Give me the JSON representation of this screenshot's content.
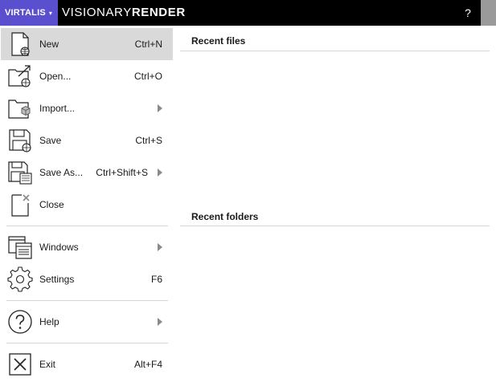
{
  "titlebar": {
    "brand": "VIRTALIS",
    "brand_caret": "▾",
    "app_name_light": "VISIONARY",
    "app_name_bold": "RENDER",
    "help": "?"
  },
  "menu": {
    "new": {
      "label": "New",
      "shortcut": "Ctrl+N"
    },
    "open": {
      "label": "Open...",
      "shortcut": "Ctrl+O"
    },
    "import": {
      "label": "Import..."
    },
    "save": {
      "label": "Save",
      "shortcut": "Ctrl+S"
    },
    "save_as": {
      "label": "Save As...",
      "shortcut": "Ctrl+Shift+S"
    },
    "close": {
      "label": "Close"
    },
    "windows": {
      "label": "Windows"
    },
    "settings": {
      "label": "Settings",
      "shortcut": "F6"
    },
    "help": {
      "label": "Help"
    },
    "exit": {
      "label": "Exit",
      "shortcut": "Alt+F4"
    }
  },
  "recent": {
    "files_title": "Recent files",
    "folders_title": "Recent folders"
  },
  "colors": {
    "brand": "#5a4fcf",
    "titlebar": "#000000",
    "active_item": "#d9d9d9"
  }
}
